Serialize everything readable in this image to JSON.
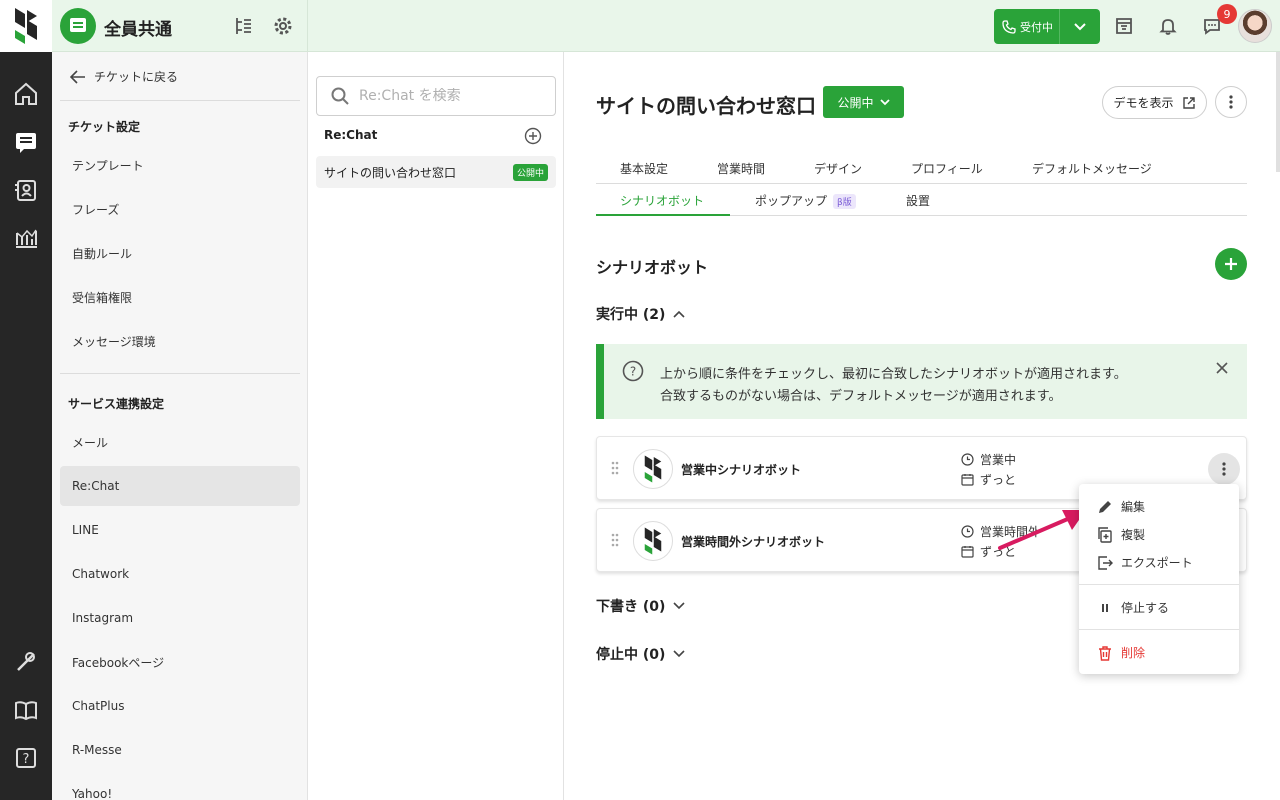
{
  "header": {
    "title": "全員共通",
    "status_label": "受付中",
    "notification_count": "9"
  },
  "sidebar": {
    "back_label": "チケットに戻る",
    "section1_title": "チケット設定",
    "section1_items": [
      "テンプレート",
      "フレーズ",
      "自動ルール",
      "受信箱権限",
      "メッセージ環境"
    ],
    "section2_title": "サービス連携設定",
    "section2_items": [
      "メール",
      "Re:Chat",
      "LINE",
      "Chatwork",
      "Instagram",
      "Facebookページ",
      "ChatPlus",
      "R-Messe",
      "Yahoo!"
    ],
    "active_item": "Re:Chat"
  },
  "list": {
    "search_placeholder": "Re:Chat を検索",
    "group_title": "Re:Chat",
    "items": [
      {
        "label": "サイトの問い合わせ窓口",
        "badge": "公開中"
      }
    ]
  },
  "main": {
    "title": "サイトの問い合わせ窓口",
    "status_dropdown": "公開中",
    "demo_button": "デモを表示",
    "tabs_row1": [
      "基本設定",
      "営業時間",
      "デザイン",
      "プロフィール",
      "デフォルトメッセージ"
    ],
    "tabs_row2": [
      "シナリオボット",
      "ポップアップ",
      "設置"
    ],
    "beta_badge": "β版",
    "active_tab": "シナリオボット",
    "section_title": "シナリオボット",
    "running_label": "実行中 (2)",
    "info_line1": "上から順に条件をチェックし、最初に合致したシナリオボットが適用されます。",
    "info_line2": "合致するものがない場合は、デフォルトメッセージが適用されます。",
    "bots": [
      {
        "name": "営業中シナリオボット",
        "schedule": "営業中",
        "period": "ずっと"
      },
      {
        "name": "営業時間外シナリオボット",
        "schedule": "営業時間外",
        "period": "ずっと"
      }
    ],
    "draft_label": "下書き (0)",
    "stopped_label": "停止中 (0)"
  },
  "menu": {
    "edit": "編集",
    "duplicate": "複製",
    "export": "エクスポート",
    "pause": "停止する",
    "delete": "削除"
  },
  "colors": {
    "accent": "#2aa339",
    "header_bg": "#e9f6ea",
    "rail_bg": "#262626",
    "danger": "#e53935",
    "arrow": "#d81b60"
  }
}
